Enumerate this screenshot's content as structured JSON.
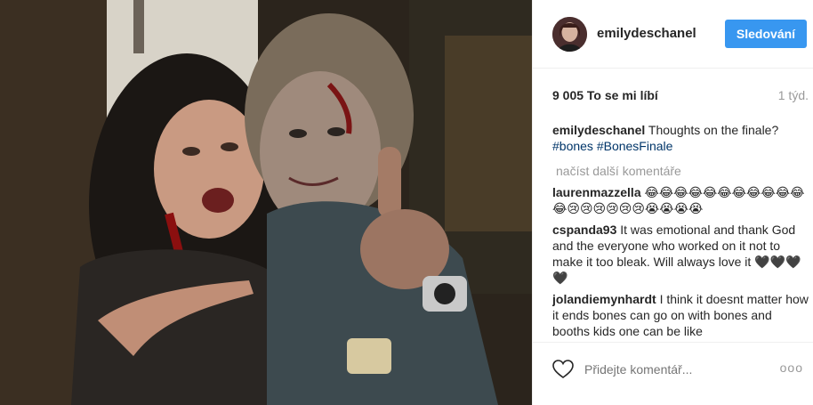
{
  "header": {
    "username": "emilydeschanel",
    "follow_label": "Sledování"
  },
  "post": {
    "likes": "9 005 To se mi líbí",
    "time": "1 týd."
  },
  "caption": {
    "user": "emilydeschanel",
    "text": "Thoughts on the finale?",
    "tags": "#bones #BonesFinale"
  },
  "load_more": "načíst další komentáře",
  "comments": [
    {
      "user": "laurenmazzella",
      "text": "😂😂😂😂😂😂😂😂😂😂😂😂😢😢😢😢😢😢😭😭😭😭"
    },
    {
      "user": "cspanda93",
      "text": "It was emotional and thank God and the everyone who worked on it not to make it too bleak. Will always love it 🖤🖤🖤🖤"
    },
    {
      "user": "jolandiemynhardt",
      "text": "I think it doesnt matter how it ends bones can go on with bones and booths kids one can be like"
    }
  ],
  "footer": {
    "comment_placeholder": "Přidejte komentář...",
    "more_label": "ooo"
  },
  "icons": {
    "heart": "heart-icon",
    "avatar": "avatar"
  }
}
